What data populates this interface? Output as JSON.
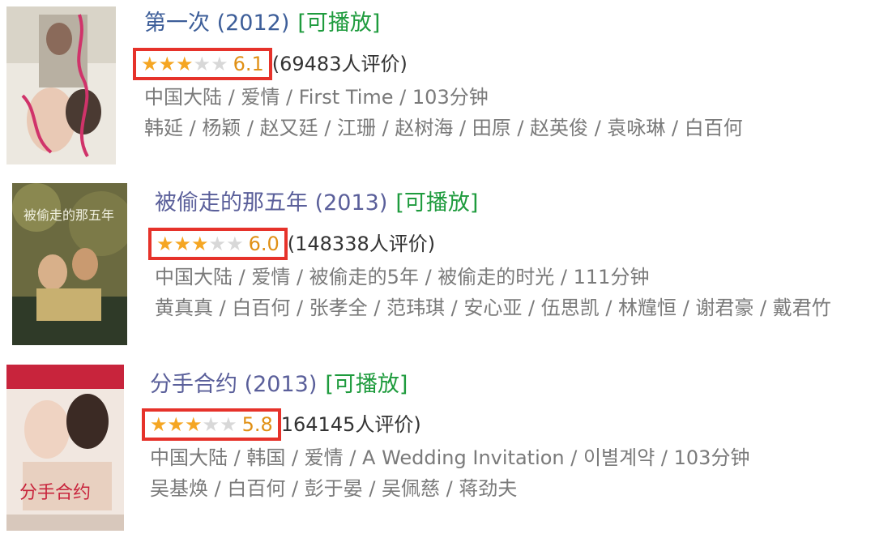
{
  "movies": [
    {
      "title": "第一次 (2012)",
      "playable": "[可播放]",
      "stars_filled": 3,
      "stars_total": 5,
      "score": "6.1",
      "votes": "(69483人评价)",
      "meta": "中国大陆 / 爱情 / First Time / 103分钟",
      "cast": "韩延 / 杨颖 / 赵又廷 / 江珊 / 赵树海 / 田原 / 赵英俊 / 袁咏琳 / 白百何",
      "poster_colors": [
        "#e8e4dc",
        "#c03a62",
        "#3a3a3a"
      ]
    },
    {
      "title": "被偷走的那五年 (2013)",
      "playable": "[可播放]",
      "stars_filled": 3,
      "stars_total": 5,
      "score": "6.0",
      "votes": "(148338人评价)",
      "meta": "中国大陆 / 爱情 / 被偷走的5年 / 被偷走的时光 / 111分钟",
      "cast": "黄真真 / 白百何 / 张孝全 / 范玮琪 / 安心亚 / 伍思凯 / 林韑恒 / 谢君豪 / 戴君竹",
      "poster_colors": [
        "#6a6a3e",
        "#c9a24a",
        "#2e3a2a"
      ]
    },
    {
      "title": "分手合约 (2013)",
      "playable": "[可播放]",
      "stars_filled": 3,
      "stars_total": 5,
      "score": "5.8",
      "votes": "164145人评价)",
      "meta": "中国大陆 / 韩国 / 爱情 / A Wedding Invitation / 이별계약 / 103分钟",
      "cast": "吴基焕 / 白百何 / 彭于晏 / 吴佩慈 / 蒋劲夫",
      "poster_colors": [
        "#f0e6df",
        "#c8243c",
        "#3b2a24"
      ]
    }
  ],
  "accent": {
    "title": "#3d5e99",
    "playable": "#1e9b3d",
    "score": "#e09015",
    "highlight_box": "#e6322a"
  }
}
